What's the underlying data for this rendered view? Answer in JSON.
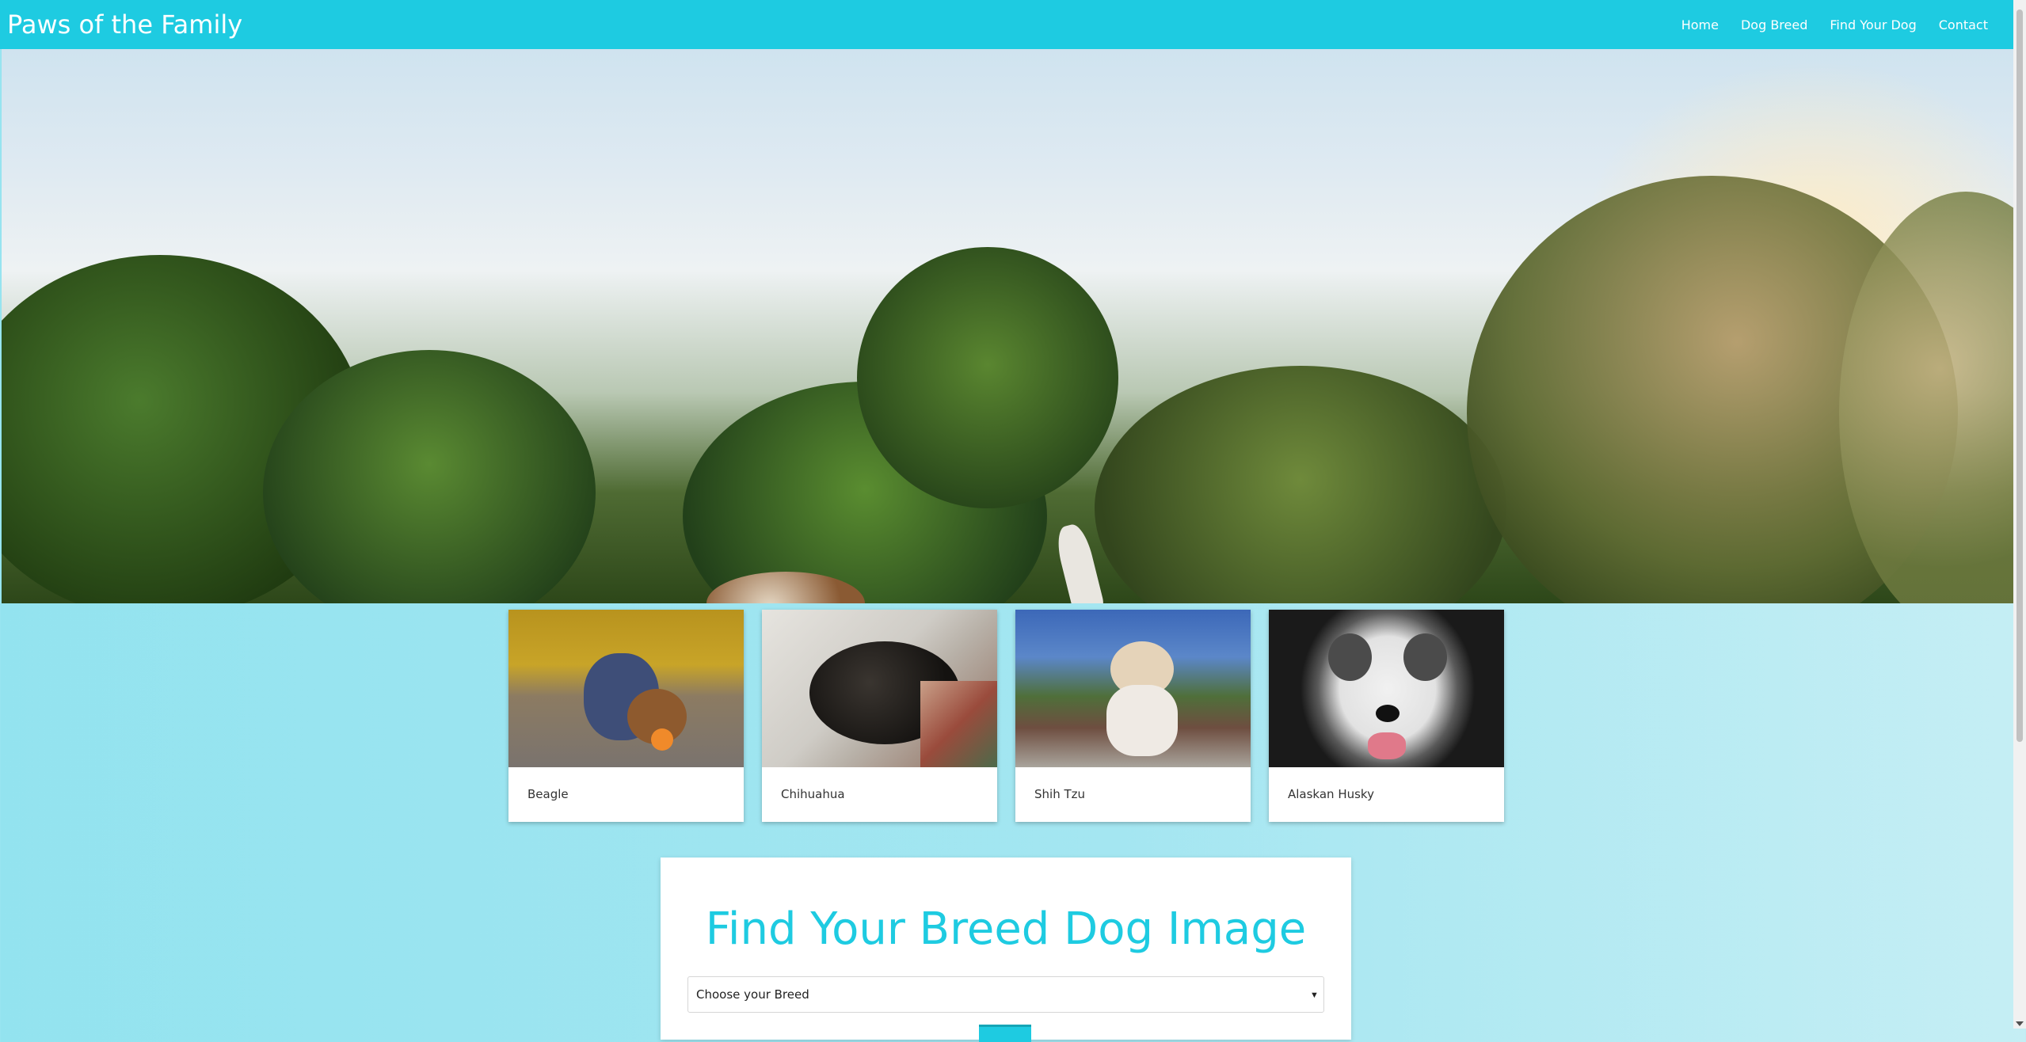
{
  "navbar": {
    "brand": "Paws of the Family",
    "links": [
      "Home",
      "Dog Breed",
      "Find Your Dog",
      "Contact"
    ]
  },
  "breeds": [
    {
      "label": "Beagle"
    },
    {
      "label": "Chihuahua"
    },
    {
      "label": "Shih Tzu"
    },
    {
      "label": "Alaskan Husky"
    }
  ],
  "finder": {
    "title": "Find Your Breed Dog Image",
    "select_value": "Choose your Breed"
  },
  "colors": {
    "accent": "#1ecbe1",
    "background": "#a4e6f1"
  }
}
